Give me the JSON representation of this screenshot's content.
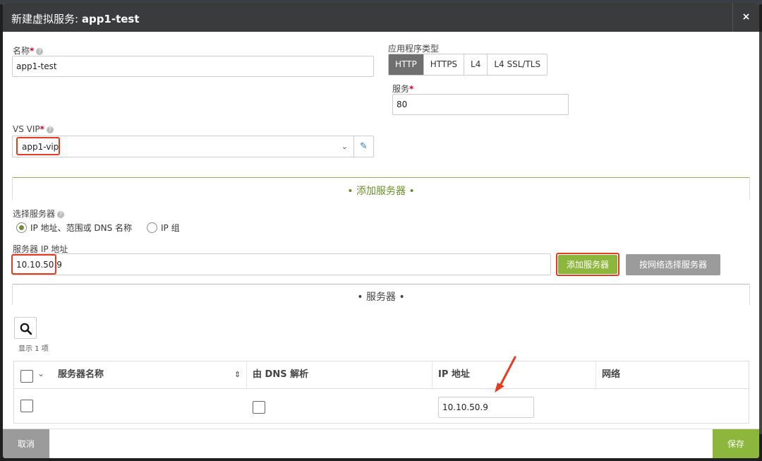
{
  "header": {
    "title_prefix": "新建虚拟服务: ",
    "title_name": "app1-test",
    "close_label": "×"
  },
  "form": {
    "name_label": "名称",
    "name_value": "app1-test",
    "app_type_label": "应用程序类型",
    "app_types": [
      "HTTP",
      "HTTPS",
      "L4",
      "L4 SSL/TLS"
    ],
    "app_type_selected": "HTTP",
    "service_label": "服务",
    "service_value": "80",
    "vsvip_label": "VS VIP",
    "vsvip_value": "app1-vip",
    "required_mark": "*",
    "help_mark": "?"
  },
  "add_server_section": {
    "title": "• 添加服务器 •",
    "select_server_label": "选择服务器",
    "radio_options": [
      "IP 地址、范围或 DNS 名称",
      "IP 组"
    ],
    "radio_selected_index": 0,
    "server_ip_label": "服务器 IP 地址",
    "server_ip_value": "10.10.50.9",
    "add_server_button": "添加服务器",
    "select_by_network_button": "按网络选择服务器"
  },
  "servers_section": {
    "title": "• 服务器 •",
    "count_text": "显示 1 项",
    "columns": [
      "服务器名称",
      "由 DNS 解析",
      "IP 地址",
      "网络"
    ],
    "rows": [
      {
        "name": "",
        "dns_resolved": false,
        "ip": "10.10.50.9",
        "network": ""
      }
    ]
  },
  "footer": {
    "cancel_label": "取消",
    "save_label": "保存"
  },
  "colors": {
    "accent_green": "#8cb63c",
    "highlight_red": "#e53b1f",
    "header_bg": "#3a3b3c"
  }
}
